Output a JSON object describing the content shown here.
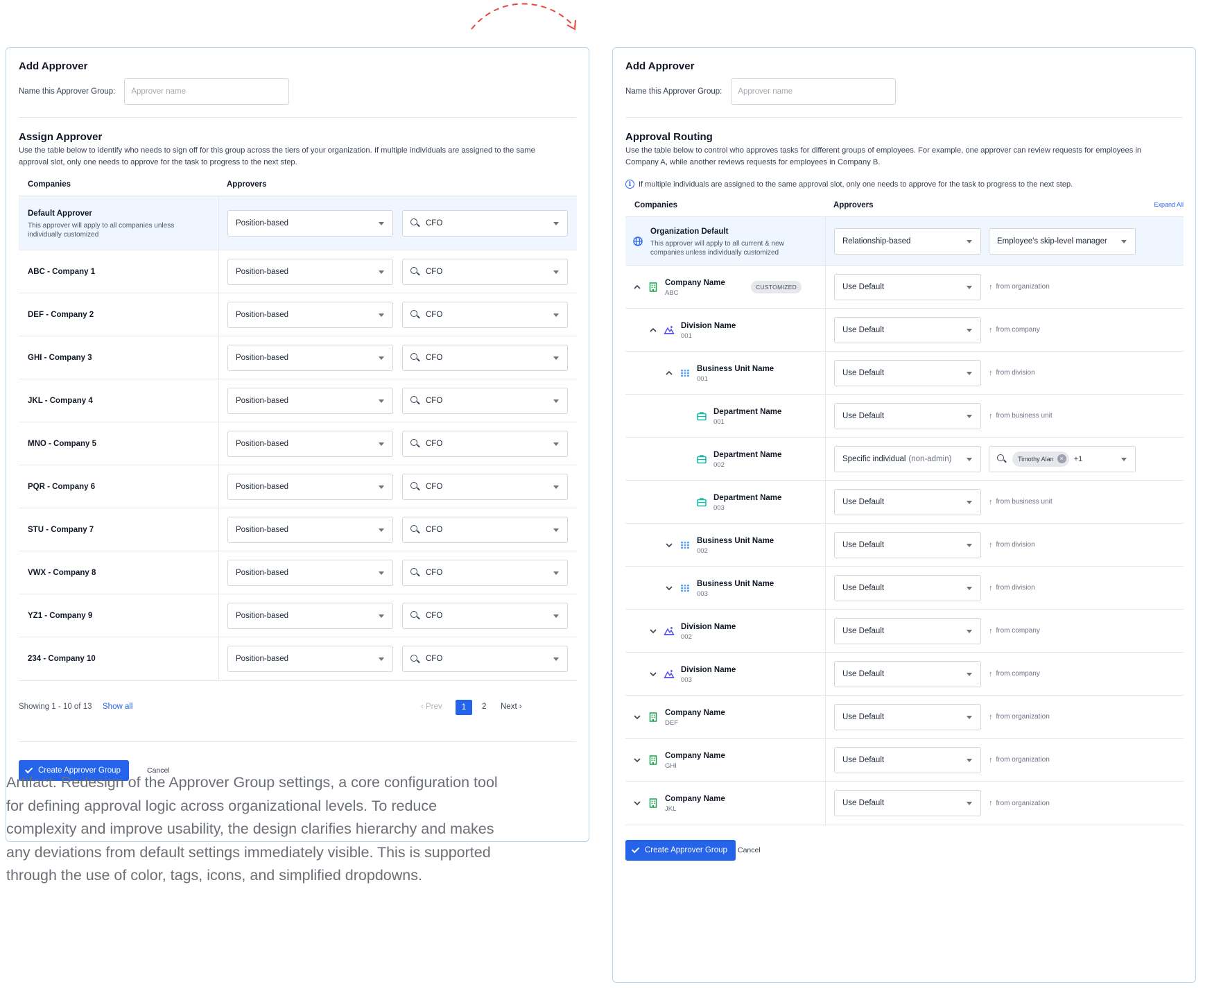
{
  "left": {
    "title": "Add Approver",
    "name_label": "Name this Approver Group:",
    "name_placeholder": "Approver name",
    "section_title": "Assign Approver",
    "section_desc": "Use the table below to identify who needs to sign off for this group across the tiers of your organization. If multiple individuals are assigned to the same approval slot, only one needs to approve for the task to progress to the next step.",
    "col_companies": "Companies",
    "col_approvers": "Approvers",
    "default_row": {
      "name": "Default Approver",
      "desc": "This approver will apply to all companies unless individually customized",
      "type": "Position-based",
      "value": "CFO"
    },
    "rows": [
      {
        "name": "ABC - Company 1",
        "type": "Position-based",
        "value": "CFO"
      },
      {
        "name": "DEF - Company 2",
        "type": "Position-based",
        "value": "CFO"
      },
      {
        "name": "GHI - Company 3",
        "type": "Position-based",
        "value": "CFO"
      },
      {
        "name": "JKL - Company 4",
        "type": "Position-based",
        "value": "CFO"
      },
      {
        "name": "MNO - Company 5",
        "type": "Position-based",
        "value": "CFO"
      },
      {
        "name": "PQR - Company 6",
        "type": "Position-based",
        "value": "CFO"
      },
      {
        "name": "STU - Company 7",
        "type": "Position-based",
        "value": "CFO"
      },
      {
        "name": "VWX - Company 8",
        "type": "Position-based",
        "value": "CFO"
      },
      {
        "name": "YZ1 - Company 9",
        "type": "Position-based",
        "value": "CFO"
      },
      {
        "name": "234 - Company 10",
        "type": "Position-based",
        "value": "CFO"
      }
    ],
    "pagination": {
      "showing": "Showing 1 - 10 of 13",
      "show_all": "Show all",
      "prev": "Prev",
      "page1": "1",
      "page2": "2",
      "next": "Next"
    },
    "create_button": "Create Approver Group",
    "cancel": "Cancel"
  },
  "right": {
    "title": "Add Approver",
    "name_label": "Name this Approver Group:",
    "name_placeholder": "Approver name",
    "section_title": "Approval Routing",
    "section_desc": "Use the table below to control who approves tasks for different groups of employees. For example, one approver can review requests for employees in Company A, while another reviews requests for employees in Company B.",
    "info_text": "If multiple individuals are assigned to the same approval slot, only one needs to approve for the task to progress to the next step.",
    "col_companies": "Companies",
    "col_approvers": "Approvers",
    "expand_all": "Expand All",
    "org_default": {
      "name": "Organization Default",
      "desc": "This approver will apply to all current & new companies unless individually customized",
      "type": "Relationship-based",
      "value": "Employee's skip-level manager",
      "icon": "globe-icon"
    },
    "rows": [
      {
        "kind": "company",
        "name": "Company Name",
        "code": "ABC",
        "chevron": "up",
        "badge": "CUSTOMIZED",
        "select": "Use Default",
        "inherit": "from organization"
      },
      {
        "kind": "division",
        "name": "Division Name",
        "code": "001",
        "chevron": "up",
        "select": "Use Default",
        "inherit": "from company"
      },
      {
        "kind": "business-unit",
        "name": "Business Unit Name",
        "code": "001",
        "chevron": "up",
        "select": "Use Default",
        "inherit": "from division"
      },
      {
        "kind": "department",
        "name": "Department Name",
        "code": "001",
        "select": "Use Default",
        "inherit": "from business unit"
      },
      {
        "kind": "department",
        "name": "Department Name",
        "code": "002",
        "select": "Specific individual",
        "select_muted": "(non-admin)",
        "chip": "Timothy Alan",
        "more": "+1"
      },
      {
        "kind": "department",
        "name": "Department Name",
        "code": "003",
        "select": "Use Default",
        "inherit": "from business unit"
      },
      {
        "kind": "business-unit",
        "name": "Business Unit Name",
        "code": "002",
        "chevron": "down",
        "select": "Use Default",
        "inherit": "from division"
      },
      {
        "kind": "business-unit",
        "name": "Business Unit Name",
        "code": "003",
        "chevron": "down",
        "select": "Use Default",
        "inherit": "from division"
      },
      {
        "kind": "division",
        "name": "Division Name",
        "code": "002",
        "chevron": "down",
        "select": "Use Default",
        "inherit": "from company"
      },
      {
        "kind": "division",
        "name": "Division Name",
        "code": "003",
        "chevron": "down",
        "select": "Use Default",
        "inherit": "from company"
      },
      {
        "kind": "company",
        "name": "Company Name",
        "code": "DEF",
        "chevron": "down",
        "select": "Use Default",
        "inherit": "from organization"
      },
      {
        "kind": "company",
        "name": "Company Name",
        "code": "GHI",
        "chevron": "down",
        "select": "Use Default",
        "inherit": "from organization"
      },
      {
        "kind": "company",
        "name": "Company Name",
        "code": "JKL",
        "chevron": "down",
        "select": "Use Default",
        "inherit": "from organization"
      }
    ],
    "create_button": "Create Approver Group",
    "cancel": "Cancel"
  },
  "caption": "Artifact: Redesign of the Approver Group settings, a core configuration tool for defining approval logic across organizational levels. To reduce complexity and improve usability, the design clarifies hierarchy and makes any deviations from default settings immediately visible. This is supported through the use of color, tags, icons, and simplified dropdowns.",
  "colors": {
    "accent": "#2563eb",
    "company_icon": "#16a34a",
    "division_icon": "#4f46e5",
    "business_unit_icon": "#60a5fa",
    "department_icon": "#14b8a6",
    "arrow": "#e8473c"
  }
}
